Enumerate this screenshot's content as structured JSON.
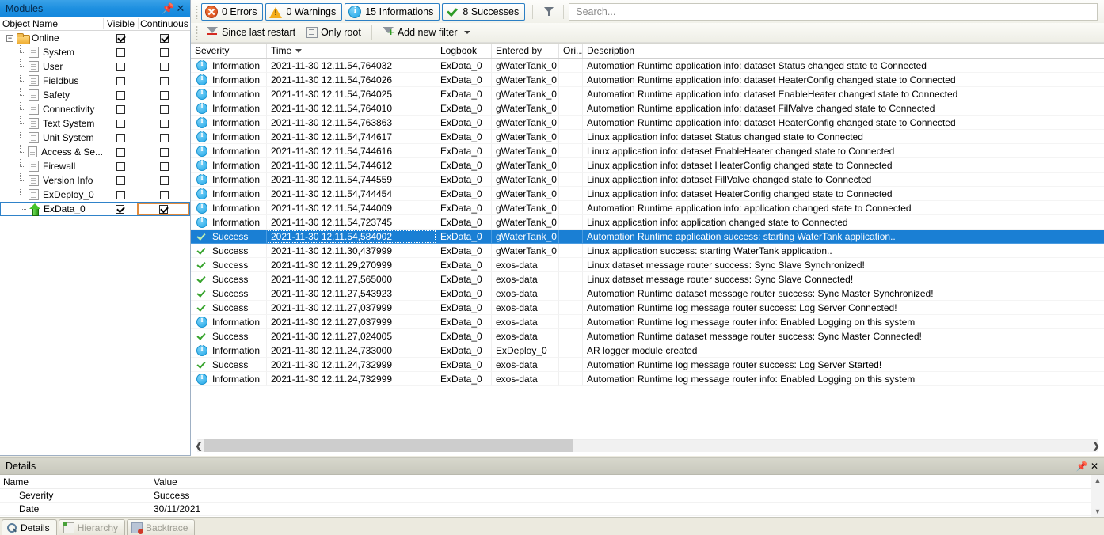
{
  "modules_panel": {
    "title": "Modules",
    "pin_icon": "pin-icon",
    "close_icon": "close-icon",
    "columns": {
      "name": "Object Name",
      "visible": "Visible",
      "continuous": "Continuous"
    },
    "rows": [
      {
        "label": "Online",
        "icon": "folder-icon",
        "level": 0,
        "expanded": true,
        "visible": true,
        "continuous": true,
        "selected": false
      },
      {
        "label": "System",
        "icon": "document-icon",
        "level": 1,
        "visible": false,
        "continuous": false,
        "selected": false
      },
      {
        "label": "User",
        "icon": "document-icon",
        "level": 1,
        "visible": false,
        "continuous": false,
        "selected": false
      },
      {
        "label": "Fieldbus",
        "icon": "document-icon",
        "level": 1,
        "visible": false,
        "continuous": false,
        "selected": false
      },
      {
        "label": "Safety",
        "icon": "document-icon",
        "level": 1,
        "visible": false,
        "continuous": false,
        "selected": false
      },
      {
        "label": "Connectivity",
        "icon": "document-icon",
        "level": 1,
        "visible": false,
        "continuous": false,
        "selected": false
      },
      {
        "label": "Text System",
        "icon": "document-icon",
        "level": 1,
        "visible": false,
        "continuous": false,
        "selected": false
      },
      {
        "label": "Unit System",
        "icon": "document-icon",
        "level": 1,
        "visible": false,
        "continuous": false,
        "selected": false
      },
      {
        "label": "Access & Se...",
        "icon": "document-icon",
        "level": 1,
        "visible": false,
        "continuous": false,
        "selected": false
      },
      {
        "label": "Firewall",
        "icon": "document-icon",
        "level": 1,
        "visible": false,
        "continuous": false,
        "selected": false
      },
      {
        "label": "Version Info",
        "icon": "document-icon",
        "level": 1,
        "visible": false,
        "continuous": false,
        "selected": false
      },
      {
        "label": "ExDeploy_0",
        "icon": "document-icon",
        "level": 1,
        "visible": false,
        "continuous": false,
        "selected": false
      },
      {
        "label": "ExData_0",
        "icon": "green-arrow-up-icon",
        "level": 1,
        "visible": true,
        "continuous": true,
        "selected": true
      }
    ]
  },
  "logger": {
    "severity_filters": [
      {
        "label": "0 Errors",
        "icon": "error-icon",
        "active": true
      },
      {
        "label": "0 Warnings",
        "icon": "warning-icon",
        "active": true
      },
      {
        "label": "15 Informations",
        "icon": "info-icon",
        "active": true
      },
      {
        "label": "8 Successes",
        "icon": "success-icon",
        "active": true
      }
    ],
    "filter_toggle_icon": "filter-funnel-icon",
    "search": {
      "placeholder": "Search...",
      "value": "",
      "icon": "search-filter-icon"
    },
    "filter_buttons": [
      {
        "label": "Since last restart",
        "icon": "funnel-restart-icon"
      },
      {
        "label": "Only root",
        "icon": "only-root-icon"
      },
      {
        "label": "Add new filter",
        "icon": "funnel-add-icon",
        "has_dropdown": true
      }
    ],
    "columns": [
      {
        "key": "severity",
        "label": "Severity"
      },
      {
        "key": "time",
        "label": "Time",
        "sorted": "desc"
      },
      {
        "key": "logbook",
        "label": "Logbook"
      },
      {
        "key": "entered_by",
        "label": "Entered by"
      },
      {
        "key": "origin",
        "label": "Ori..."
      },
      {
        "key": "description",
        "label": "Description"
      }
    ],
    "rows": [
      {
        "severity": "Information",
        "time": "2021-11-30 12.11.54,764032",
        "logbook": "ExData_0",
        "entered_by": "gWaterTank_0",
        "origin": "",
        "description": "Automation Runtime application info: dataset Status changed state to Connected",
        "selected": false
      },
      {
        "severity": "Information",
        "time": "2021-11-30 12.11.54,764026",
        "logbook": "ExData_0",
        "entered_by": "gWaterTank_0",
        "origin": "",
        "description": "Automation Runtime application info: dataset HeaterConfig changed state to Connected",
        "selected": false
      },
      {
        "severity": "Information",
        "time": "2021-11-30 12.11.54,764025",
        "logbook": "ExData_0",
        "entered_by": "gWaterTank_0",
        "origin": "",
        "description": "Automation Runtime application info: dataset EnableHeater changed state to Connected",
        "selected": false
      },
      {
        "severity": "Information",
        "time": "2021-11-30 12.11.54,764010",
        "logbook": "ExData_0",
        "entered_by": "gWaterTank_0",
        "origin": "",
        "description": "Automation Runtime application info: dataset FillValve changed state to Connected",
        "selected": false
      },
      {
        "severity": "Information",
        "time": "2021-11-30 12.11.54,763863",
        "logbook": "ExData_0",
        "entered_by": "gWaterTank_0",
        "origin": "",
        "description": "Automation Runtime application info: dataset HeaterConfig changed state to Connected",
        "selected": false
      },
      {
        "severity": "Information",
        "time": "2021-11-30 12.11.54,744617",
        "logbook": "ExData_0",
        "entered_by": "gWaterTank_0",
        "origin": "",
        "description": "Linux application info: dataset Status changed state to Connected",
        "selected": false
      },
      {
        "severity": "Information",
        "time": "2021-11-30 12.11.54,744616",
        "logbook": "ExData_0",
        "entered_by": "gWaterTank_0",
        "origin": "",
        "description": "Linux application info: dataset EnableHeater changed state to Connected",
        "selected": false
      },
      {
        "severity": "Information",
        "time": "2021-11-30 12.11.54,744612",
        "logbook": "ExData_0",
        "entered_by": "gWaterTank_0",
        "origin": "",
        "description": "Linux application info: dataset HeaterConfig changed state to Connected",
        "selected": false
      },
      {
        "severity": "Information",
        "time": "2021-11-30 12.11.54,744559",
        "logbook": "ExData_0",
        "entered_by": "gWaterTank_0",
        "origin": "",
        "description": "Linux application info: dataset FillValve changed state to Connected",
        "selected": false
      },
      {
        "severity": "Information",
        "time": "2021-11-30 12.11.54,744454",
        "logbook": "ExData_0",
        "entered_by": "gWaterTank_0",
        "origin": "",
        "description": "Linux application info: dataset HeaterConfig changed state to Connected",
        "selected": false
      },
      {
        "severity": "Information",
        "time": "2021-11-30 12.11.54,744009",
        "logbook": "ExData_0",
        "entered_by": "gWaterTank_0",
        "origin": "",
        "description": "Automation Runtime application info: application changed state to Connected",
        "selected": false
      },
      {
        "severity": "Information",
        "time": "2021-11-30 12.11.54,723745",
        "logbook": "ExData_0",
        "entered_by": "gWaterTank_0",
        "origin": "",
        "description": "Linux application info: application changed state to Connected",
        "selected": false
      },
      {
        "severity": "Success",
        "time": "2021-11-30 12.11.54,584002",
        "logbook": "ExData_0",
        "entered_by": "gWaterTank_0",
        "origin": "",
        "description": "Automation Runtime application success: starting WaterTank application..",
        "selected": true
      },
      {
        "severity": "Success",
        "time": "2021-11-30 12.11.30,437999",
        "logbook": "ExData_0",
        "entered_by": "gWaterTank_0",
        "origin": "",
        "description": "Linux application success: starting WaterTank application..",
        "selected": false
      },
      {
        "severity": "Success",
        "time": "2021-11-30 12.11.29,270999",
        "logbook": "ExData_0",
        "entered_by": "exos-data",
        "origin": "",
        "description": "Linux dataset message router success: Sync Slave Synchronized!",
        "selected": false
      },
      {
        "severity": "Success",
        "time": "2021-11-30 12.11.27,565000",
        "logbook": "ExData_0",
        "entered_by": "exos-data",
        "origin": "",
        "description": "Linux dataset message router success: Sync Slave Connected!",
        "selected": false
      },
      {
        "severity": "Success",
        "time": "2021-11-30 12.11.27,543923",
        "logbook": "ExData_0",
        "entered_by": "exos-data",
        "origin": "",
        "description": "Automation Runtime dataset message router success: Sync Master Synchronized!",
        "selected": false
      },
      {
        "severity": "Success",
        "time": "2021-11-30 12.11.27,037999",
        "logbook": "ExData_0",
        "entered_by": "exos-data",
        "origin": "",
        "description": "Automation Runtime log message router success: Log Server Connected!",
        "selected": false
      },
      {
        "severity": "Information",
        "time": "2021-11-30 12.11.27,037999",
        "logbook": "ExData_0",
        "entered_by": "exos-data",
        "origin": "",
        "description": "Automation Runtime log message router info: Enabled Logging on this system",
        "selected": false
      },
      {
        "severity": "Success",
        "time": "2021-11-30 12.11.27,024005",
        "logbook": "ExData_0",
        "entered_by": "exos-data",
        "origin": "",
        "description": "Automation Runtime dataset message router success: Sync Master Connected!",
        "selected": false
      },
      {
        "severity": "Information",
        "time": "2021-11-30 12.11.24,733000",
        "logbook": "ExData_0",
        "entered_by": "ExDeploy_0",
        "origin": "",
        "description": "AR logger module created",
        "selected": false
      },
      {
        "severity": "Success",
        "time": "2021-11-30 12.11.24,732999",
        "logbook": "ExData_0",
        "entered_by": "exos-data",
        "origin": "",
        "description": "Automation Runtime log message router success: Log Server Started!",
        "selected": false
      },
      {
        "severity": "Information",
        "time": "2021-11-30 12.11.24,732999",
        "logbook": "ExData_0",
        "entered_by": "exos-data",
        "origin": "",
        "description": "Automation Runtime log message router info: Enabled Logging on this system",
        "selected": false
      }
    ],
    "hscroll": {
      "left_arrow": "chevron-left-icon",
      "right_arrow": "chevron-right-icon"
    }
  },
  "details_panel": {
    "title": "Details",
    "pin_icon": "pin-icon",
    "close_icon": "close-icon",
    "columns": {
      "name": "Name",
      "value": "Value"
    },
    "rows": [
      {
        "name": "Severity",
        "value": "Success"
      },
      {
        "name": "Date",
        "value": "30/11/2021"
      }
    ],
    "scroll_up_icon": "chevron-up-icon",
    "scroll_down_icon": "chevron-down-icon"
  },
  "bottom_tabs": [
    {
      "label": "Details",
      "icon": "magnifier-icon",
      "active": true
    },
    {
      "label": "Hierarchy",
      "icon": "hierarchy-icon",
      "active": false
    },
    {
      "label": "Backtrace",
      "icon": "backtrace-icon",
      "active": false
    }
  ],
  "colors": {
    "title_blue": "#1e90e0",
    "selection_blue": "#1a7fd4",
    "accent_orange": "#e08a3c",
    "info_blue": "#22a8e8",
    "success_green": "#35a32b",
    "error_red": "#d8471a",
    "warning_yellow": "#f5ad1b"
  }
}
